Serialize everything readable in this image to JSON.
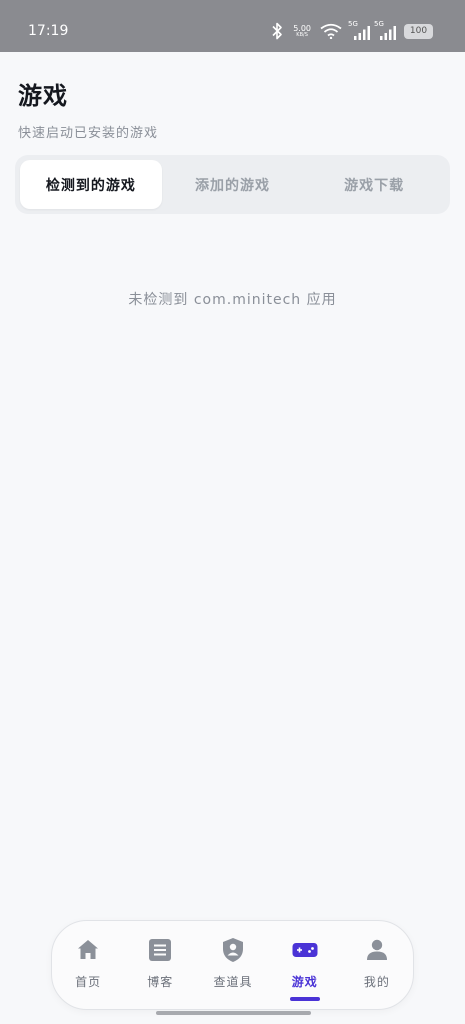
{
  "status_bar": {
    "time": "17:19",
    "net_speed_value": "5.00",
    "net_speed_unit": "KB/S",
    "signal_1": "5G",
    "signal_2": "5G",
    "battery": "100"
  },
  "header": {
    "title": "游戏",
    "subtitle": "快速启动已安装的游戏"
  },
  "tabs": [
    {
      "label": "检测到的游戏",
      "active": true
    },
    {
      "label": "添加的游戏",
      "active": false
    },
    {
      "label": "游戏下载",
      "active": false
    }
  ],
  "empty_message": "未检测到 com.minitech 应用",
  "bottom_nav": {
    "items": [
      {
        "label": "首页",
        "icon": "home-icon"
      },
      {
        "label": "博客",
        "icon": "article-icon"
      },
      {
        "label": "查道具",
        "icon": "shield-user-icon"
      },
      {
        "label": "游戏",
        "icon": "gamepad-icon",
        "active": true
      },
      {
        "label": "我的",
        "icon": "person-icon"
      }
    ]
  },
  "colors": {
    "accent": "#4a33d6",
    "status_bar_bg": "#8a8b90",
    "page_bg": "#f7f8fa",
    "title_text": "#15181f",
    "muted_text": "#8a8f98"
  }
}
